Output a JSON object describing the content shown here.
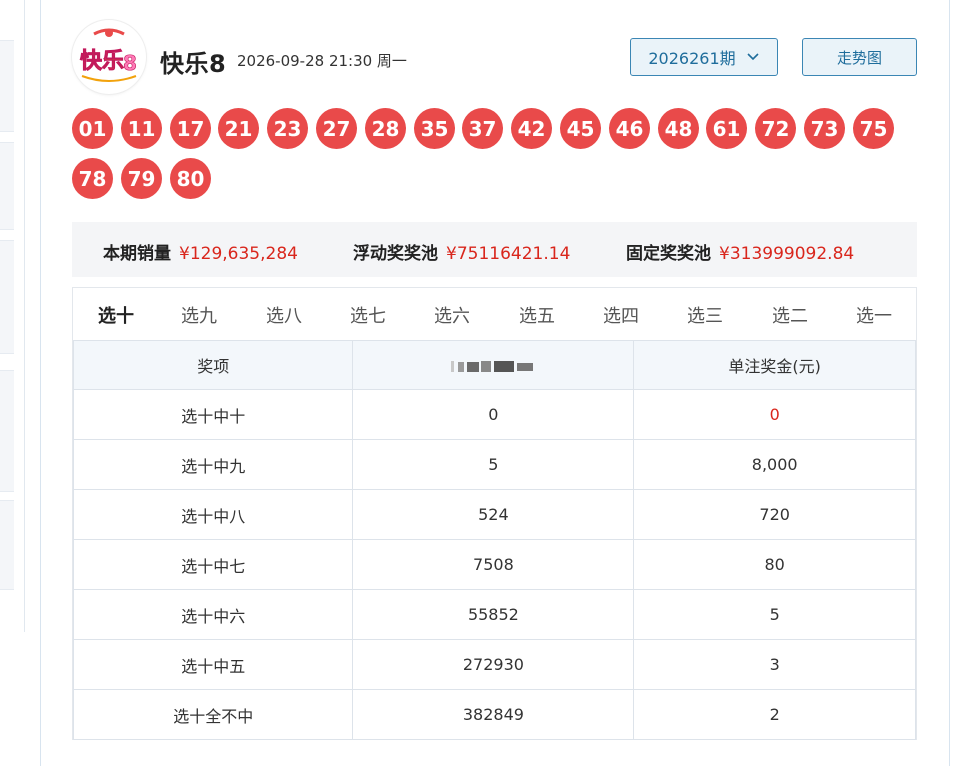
{
  "lottery": {
    "logo_text": "快乐8",
    "title": "快乐8",
    "draw_datetime": "2026-09-28 21:30 周一",
    "issue": "2026261期",
    "trend_button": "走势图"
  },
  "numbers": [
    "01",
    "11",
    "17",
    "21",
    "23",
    "27",
    "28",
    "35",
    "37",
    "42",
    "45",
    "46",
    "48",
    "61",
    "72",
    "73",
    "75",
    "78",
    "79",
    "80"
  ],
  "pool": {
    "sales_label": "本期销量",
    "sales_value": "¥129,635,284",
    "floating_label": "浮动奖奖池",
    "floating_value": "¥75116421.14",
    "fixed_label": "固定奖奖池",
    "fixed_value": "¥313999092.84"
  },
  "tabs": [
    "选十",
    "选九",
    "选八",
    "选七",
    "选六",
    "选五",
    "选四",
    "选三",
    "选二",
    "选一"
  ],
  "active_tab": "选十",
  "table": {
    "headers": [
      "奖项",
      "",
      "单注奖金(元)"
    ],
    "rows": [
      {
        "item": "选十中十",
        "count": "0",
        "prize": "0",
        "highlight": true
      },
      {
        "item": "选十中九",
        "count": "5",
        "prize": "8,000"
      },
      {
        "item": "选十中八",
        "count": "524",
        "prize": "720"
      },
      {
        "item": "选十中七",
        "count": "7508",
        "prize": "80"
      },
      {
        "item": "选十中六",
        "count": "55852",
        "prize": "5"
      },
      {
        "item": "选十中五",
        "count": "272930",
        "prize": "3"
      },
      {
        "item": "选十全不中",
        "count": "382849",
        "prize": "2"
      }
    ]
  },
  "colors": {
    "ball": "#e94a4a",
    "accent": "#1f6d9c",
    "money": "#d9261c"
  }
}
